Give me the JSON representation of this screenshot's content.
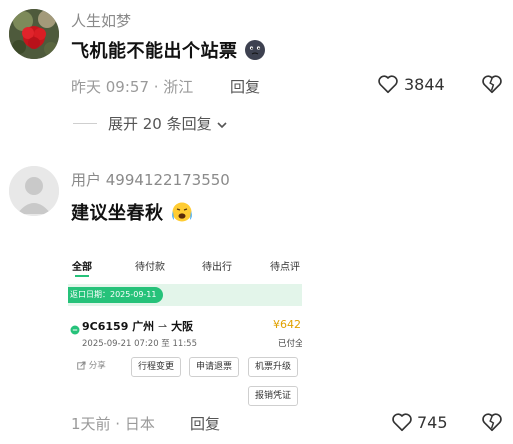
{
  "comment1": {
    "username": "人生如梦",
    "text": "飞机能不能出个站票",
    "time": "昨天 09:57 · 浙江",
    "reply_label": "回复",
    "like_count": "3844",
    "expand_label": "展开 20 条回复"
  },
  "comment2": {
    "username": "用户 4994122173550",
    "text": "建议坐春秋",
    "time": "1天前 · 日本",
    "reply_label": "回复",
    "like_count": "745"
  },
  "card": {
    "tabs": [
      "全部",
      "待付款",
      "待出行",
      "待点评"
    ],
    "date_banner": "返口日期：2025-09-11",
    "flight_no": "9C6159",
    "from": "广州",
    "to": "大阪",
    "price": "¥642",
    "time_range": "2025-09-21 07:20 至 11:55",
    "status": "已付全",
    "share_label": "分享",
    "buttons": [
      "行程变更",
      "申请退票",
      "机票升级",
      "报销凭证"
    ]
  },
  "colors": {
    "accent_green": "#26c27a",
    "banner_bg": "#e3f5ea",
    "price_color": "#e0a100"
  },
  "icons": [
    "heart-outline-icon",
    "broken-heart-icon",
    "chevron-down-icon",
    "share-icon",
    "round-trip-icon",
    "default-avatar-icon"
  ]
}
